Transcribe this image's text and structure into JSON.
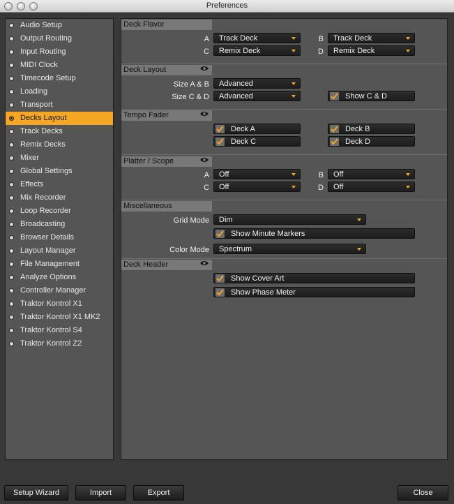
{
  "window": {
    "title": "Preferences"
  },
  "sidebar": {
    "items": [
      {
        "label": "Audio Setup",
        "active": false
      },
      {
        "label": "Output Routing",
        "active": false
      },
      {
        "label": "Input Routing",
        "active": false
      },
      {
        "label": "MIDI Clock",
        "active": false
      },
      {
        "label": "Timecode Setup",
        "active": false
      },
      {
        "label": "Loading",
        "active": false
      },
      {
        "label": "Transport",
        "active": false
      },
      {
        "label": "Decks Layout",
        "active": true
      },
      {
        "label": "Track Decks",
        "active": false
      },
      {
        "label": "Remix Decks",
        "active": false
      },
      {
        "label": "Mixer",
        "active": false
      },
      {
        "label": "Global Settings",
        "active": false
      },
      {
        "label": "Effects",
        "active": false
      },
      {
        "label": "Mix Recorder",
        "active": false
      },
      {
        "label": "Loop Recorder",
        "active": false
      },
      {
        "label": "Broadcasting",
        "active": false
      },
      {
        "label": "Browser Details",
        "active": false
      },
      {
        "label": "Layout Manager",
        "active": false
      },
      {
        "label": "File Management",
        "active": false
      },
      {
        "label": "Analyze Options",
        "active": false
      },
      {
        "label": "Controller Manager",
        "active": false
      },
      {
        "label": "Traktor Kontrol X1",
        "active": false
      },
      {
        "label": "Traktor Kontrol X1 MK2",
        "active": false
      },
      {
        "label": "Traktor Kontrol S4",
        "active": false
      },
      {
        "label": "Traktor Kontrol Z2",
        "active": false
      }
    ]
  },
  "deck_flavor": {
    "title": "Deck Flavor",
    "a_label": "A",
    "a_value": "Track Deck",
    "b_label": "B",
    "b_value": "Track Deck",
    "c_label": "C",
    "c_value": "Remix Deck",
    "d_label": "D",
    "d_value": "Remix Deck"
  },
  "deck_layout": {
    "title": "Deck Layout",
    "size_ab_label": "Size A & B",
    "size_ab_value": "Advanced",
    "size_cd_label": "Size C & D",
    "size_cd_value": "Advanced",
    "show_cd_label": "Show C & D",
    "show_cd_checked": true
  },
  "tempo_fader": {
    "title": "Tempo Fader",
    "deck_a": "Deck A",
    "deck_b": "Deck B",
    "deck_c": "Deck C",
    "deck_d": "Deck D",
    "checked": [
      true,
      true,
      true,
      true
    ]
  },
  "platter_scope": {
    "title": "Platter / Scope",
    "a_label": "A",
    "a_value": "Off",
    "b_label": "B",
    "b_value": "Off",
    "c_label": "C",
    "c_value": "Off",
    "d_label": "D",
    "d_value": "Off"
  },
  "miscellaneous": {
    "title": "Miscellaneous",
    "grid_mode_label": "Grid Mode",
    "grid_mode_value": "Dim",
    "minute_markers_label": "Show Minute Markers",
    "minute_markers_checked": true,
    "color_mode_label": "Color Mode",
    "color_mode_value": "Spectrum"
  },
  "deck_header": {
    "title": "Deck Header",
    "cover_art_label": "Show Cover Art",
    "cover_art_checked": true,
    "phase_meter_label": "Show Phase Meter",
    "phase_meter_checked": true
  },
  "footer": {
    "setup_wizard": "Setup Wizard",
    "import": "Import",
    "export": "Export",
    "close": "Close"
  },
  "colors": {
    "accent": "#f5a623",
    "panel": "#555555",
    "background": "#383838"
  }
}
